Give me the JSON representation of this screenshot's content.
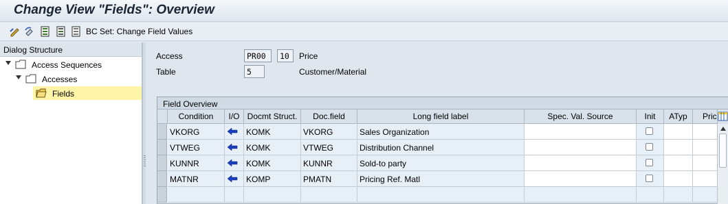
{
  "window": {
    "title": "Change View \"Fields\": Overview"
  },
  "toolbar": {
    "icons": [
      "change-display-icon",
      "other-entry-icon",
      "select-all-icon",
      "select-block-icon",
      "deselect-all-icon"
    ],
    "bc_set_label": "BC Set: Change Field Values"
  },
  "dialog_structure": {
    "header": "Dialog Structure",
    "items": [
      {
        "label": "Access Sequences",
        "level": 0,
        "expanded": true
      },
      {
        "label": "Accesses",
        "level": 1,
        "expanded": true
      },
      {
        "label": "Fields",
        "level": 2,
        "selected": true
      }
    ]
  },
  "header_fields": {
    "access": {
      "label": "Access",
      "value1": "PR00",
      "value2": "10",
      "text": "Price"
    },
    "table": {
      "label": "Table",
      "value": "5",
      "text": "Customer/Material"
    }
  },
  "field_overview": {
    "title": "Field Overview",
    "columns": [
      "Condition",
      "I/O",
      "Docmt Struct.",
      "Doc.field",
      "Long field label",
      "Spec. Val. Source",
      "Init",
      "ATyp",
      "Pric"
    ],
    "rows": [
      {
        "condition": "VKORG",
        "io": "⇐",
        "struct": "KOMK",
        "docfield": "VKORG",
        "label": "Sales Organization",
        "spec": "",
        "init": false
      },
      {
        "condition": "VTWEG",
        "io": "⇐",
        "struct": "KOMK",
        "docfield": "VTWEG",
        "label": "Distribution Channel",
        "spec": "",
        "init": false
      },
      {
        "condition": "KUNNR",
        "io": "⇐",
        "struct": "KOMK",
        "docfield": "KUNNR",
        "label": "Sold-to party",
        "spec": "",
        "init": false
      },
      {
        "condition": "MATNR",
        "io": "⇐",
        "struct": "KOMP",
        "docfield": "PMATN",
        "label": "Pricing Ref. Matl",
        "spec": "",
        "init": false
      }
    ]
  },
  "colors": {
    "accent": "#0a3fbf",
    "selected_tree": "#fef5a8",
    "folder": "#f3cf55"
  }
}
